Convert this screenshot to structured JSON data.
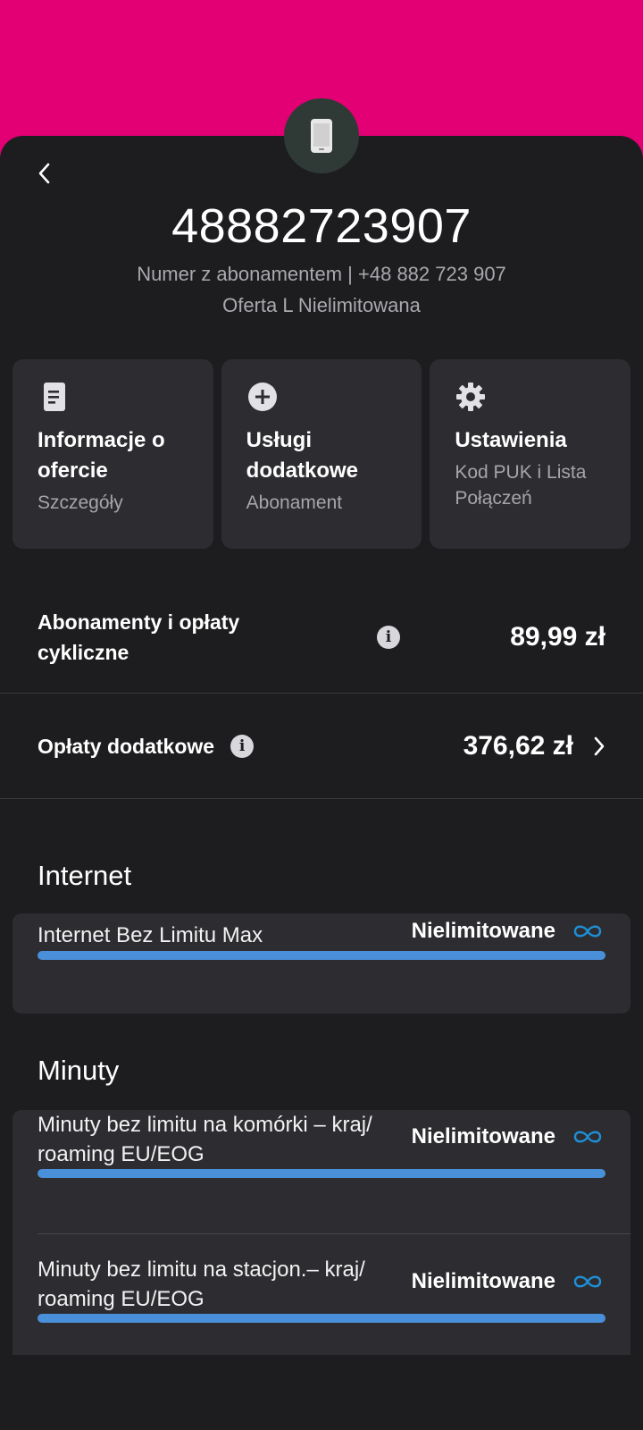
{
  "header": {
    "number": "48882723907",
    "subtitle": "Numer z abonamentem | +48 882 723 907",
    "offer": "Oferta L Nielimitowana"
  },
  "tiles": [
    {
      "icon": "document-icon",
      "title": "Informacje o ofercie",
      "subtitle": "Szczegóły"
    },
    {
      "icon": "add-circle-icon",
      "title": "Usługi dodatkowe",
      "subtitle": "Abonament"
    },
    {
      "icon": "gear-icon",
      "title": "Ustawienia",
      "subtitle": "Kod PUK i Lista Połączeń"
    }
  ],
  "charges": {
    "subscriptions_label": "Abonamenty i opłaty cykliczne",
    "subscriptions_amount": "89,99 zł",
    "extra_label": "Opłaty dodatkowe",
    "extra_amount": "376,62 zł"
  },
  "internet": {
    "title": "Internet",
    "items": [
      {
        "name": "Internet Bez Limitu Max",
        "value": "Nielimitowane",
        "fill": 1.0
      }
    ]
  },
  "minutes": {
    "title": "Minuty",
    "items": [
      {
        "name": "Minuty bez limitu na komórki – kraj/ roaming EU/EOG",
        "value": "Nielimitowane",
        "fill": 1.0
      },
      {
        "name": "Minuty bez limitu na stacjon.– kraj/ roaming EU/EOG",
        "value": "Nielimitowane",
        "fill": 1.0
      }
    ]
  },
  "colors": {
    "brand": "#e20074",
    "background": "#1d1d1f",
    "card": "#2d2d31",
    "bar": "#4a8fd9",
    "infinity": "#1e8fd6"
  }
}
